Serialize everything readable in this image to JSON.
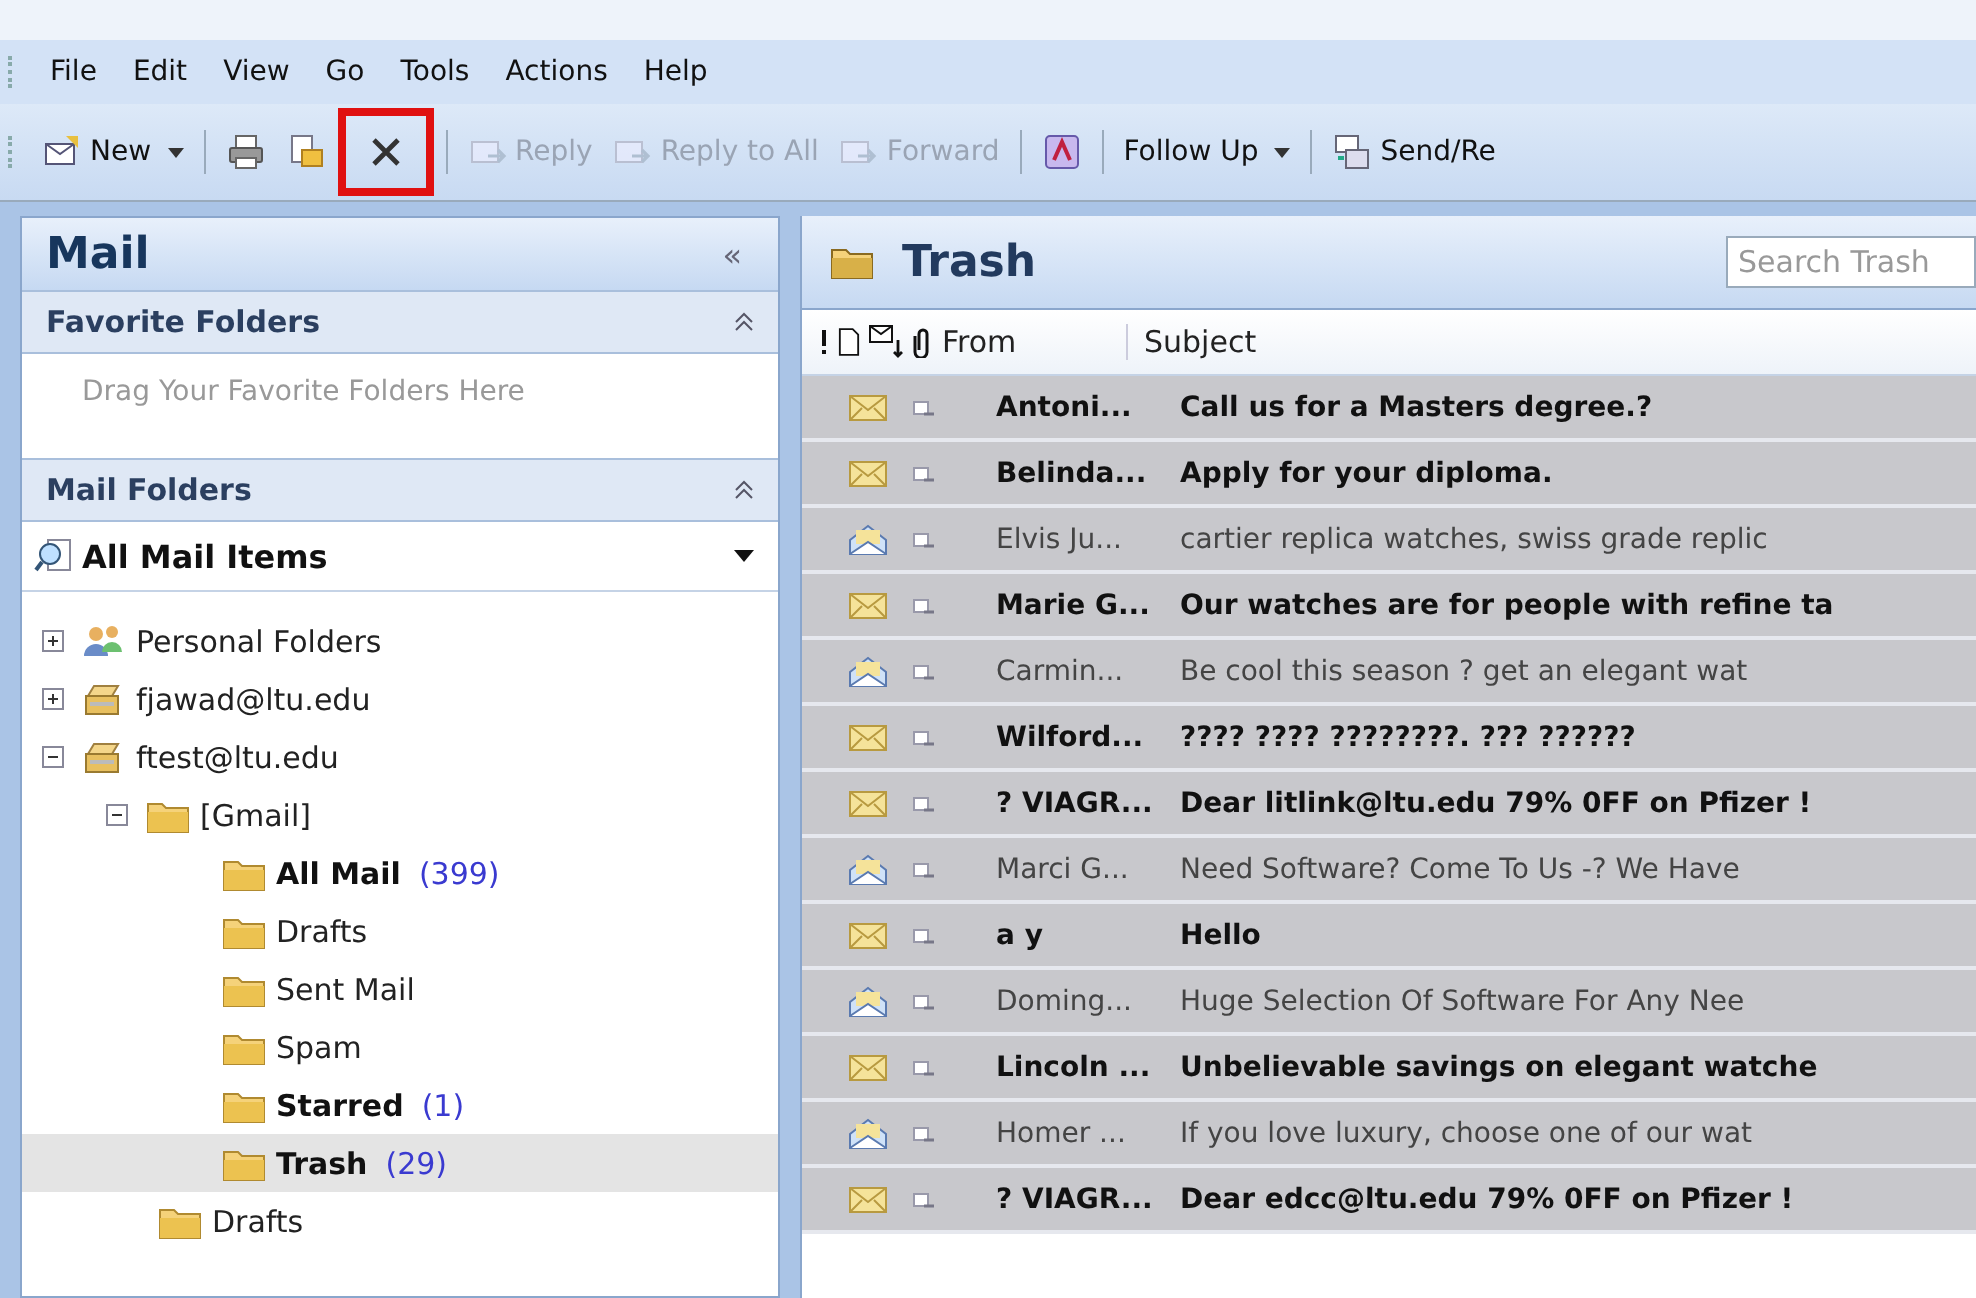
{
  "menu": [
    "File",
    "Edit",
    "View",
    "Go",
    "Tools",
    "Actions",
    "Help"
  ],
  "toolbar": [
    {
      "kind": "new",
      "label": "New",
      "disabled": false
    },
    {
      "kind": "print",
      "disabled": false
    },
    {
      "kind": "move",
      "disabled": false
    },
    {
      "kind": "delete",
      "disabled": false,
      "highlighted": true
    },
    {
      "kind": "reply",
      "label": "Reply",
      "disabled": true
    },
    {
      "kind": "replyall",
      "label": "Reply to All",
      "disabled": true
    },
    {
      "kind": "forward",
      "label": "Forward",
      "disabled": true
    },
    {
      "kind": "categorize",
      "disabled": false
    },
    {
      "kind": "followup",
      "label": "Follow Up",
      "disabled": false
    },
    {
      "kind": "sendreceive",
      "label": "Send/Re",
      "disabled": false
    }
  ],
  "nav": {
    "title": "Mail",
    "collapse": "«",
    "favorites": {
      "title": "Favorite Folders",
      "hint": "Drag Your Favorite Folders Here"
    },
    "mail_folders": {
      "title": "Mail Folders",
      "view": "All Mail Items"
    },
    "tree": [
      {
        "kind": "personal",
        "name": "Personal Folders",
        "expanded": false,
        "unread": false,
        "selected": false
      },
      {
        "kind": "account",
        "name": "fjawad@ltu.edu",
        "expanded": false,
        "unread": false,
        "selected": false
      },
      {
        "kind": "account",
        "name": "ftest@ltu.edu",
        "expanded": true,
        "unread": false,
        "selected": false,
        "children": [
          {
            "kind": "folder",
            "name": "[Gmail]",
            "expanded": true,
            "unread": false,
            "selected": false,
            "children": [
              {
                "kind": "folder",
                "name": "All Mail",
                "count": "(399)",
                "unread": true,
                "selected": false
              },
              {
                "kind": "folder",
                "name": "Drafts",
                "unread": false,
                "selected": false
              },
              {
                "kind": "folder",
                "name": "Sent Mail",
                "unread": false,
                "selected": false
              },
              {
                "kind": "folder",
                "name": "Spam",
                "unread": false,
                "selected": false
              },
              {
                "kind": "folder",
                "name": "Starred",
                "count": "(1)",
                "unread": true,
                "selected": false
              },
              {
                "kind": "folder",
                "name": "Trash",
                "count": "(29)",
                "unread": true,
                "selected": true
              }
            ]
          },
          {
            "kind": "folder",
            "name": "Drafts",
            "unread": false,
            "selected": false
          }
        ]
      }
    ]
  },
  "list": {
    "title": "Trash",
    "search": {
      "placeholder": "Search Trash"
    },
    "columns": [
      "From",
      "Subject"
    ],
    "messages": [
      {
        "from": "Antoni...",
        "subject": "Call us for a Masters degree.?",
        "unread": true
      },
      {
        "from": "Belinda...",
        "subject": "Apply for your diploma.",
        "unread": true
      },
      {
        "from": "Elvis Ju...",
        "subject": "cartier replica watches, swiss grade replic",
        "unread": false
      },
      {
        "from": "Marie G...",
        "subject": "Our watches are for people with refine ta",
        "unread": true
      },
      {
        "from": "Carmin...",
        "subject": "Be cool this season ? get an elegant wat",
        "unread": false
      },
      {
        "from": "Wilford...",
        "subject": "???? ???? ????????. ??? ??????",
        "unread": true
      },
      {
        "from": "? VIAGR...",
        "subject": "Dear litlink@ltu.edu 79% 0FF on Pfizer !",
        "unread": true
      },
      {
        "from": "Marci G...",
        "subject": "Need Software? Come To Us -? We Have",
        "unread": false
      },
      {
        "from": "a y",
        "subject": "Hello",
        "unread": true
      },
      {
        "from": "Doming...",
        "subject": "Huge Selection Of Software For Any Nee",
        "unread": false
      },
      {
        "from": "Lincoln ...",
        "subject": "Unbelievable savings on elegant watche",
        "unread": true
      },
      {
        "from": "Homer ...",
        "subject": "If you love luxury, choose one of our wat",
        "unread": false
      },
      {
        "from": "? VIAGR...",
        "subject": "Dear edcc@ltu.edu 79% 0FF on Pfizer !",
        "unread": true
      }
    ]
  }
}
